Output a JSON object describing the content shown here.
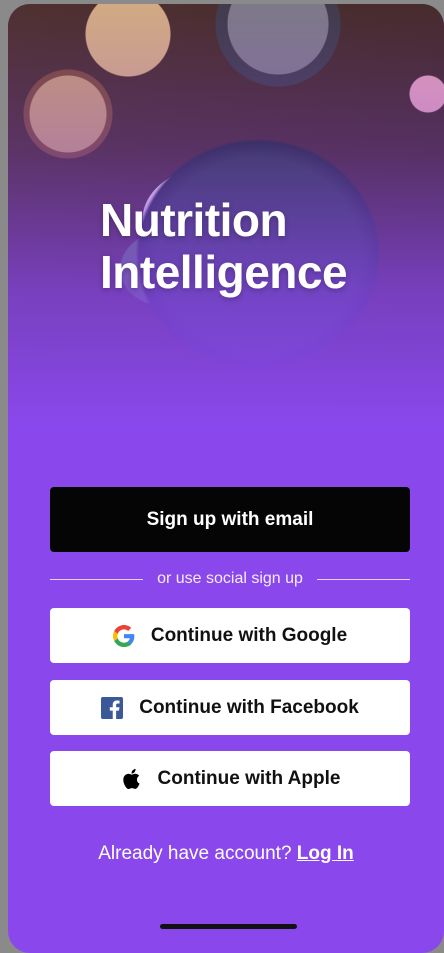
{
  "app": {
    "title_line1": "Nutrition",
    "title_line2": "Intelligence"
  },
  "actions": {
    "email_label": "Sign up with email",
    "divider_text": "or use social sign up",
    "google_label": "Continue with Google",
    "facebook_label": "Continue with Facebook",
    "apple_label": "Continue with Apple"
  },
  "footer": {
    "prompt": "Already have account?",
    "login_label": "Log In"
  },
  "icons": {
    "google": "google-icon",
    "facebook": "facebook-icon",
    "apple": "apple-icon"
  },
  "colors": {
    "brand_purple": "#8a48ec",
    "primary_button": "#050505",
    "facebook_blue": "#3b5998"
  }
}
